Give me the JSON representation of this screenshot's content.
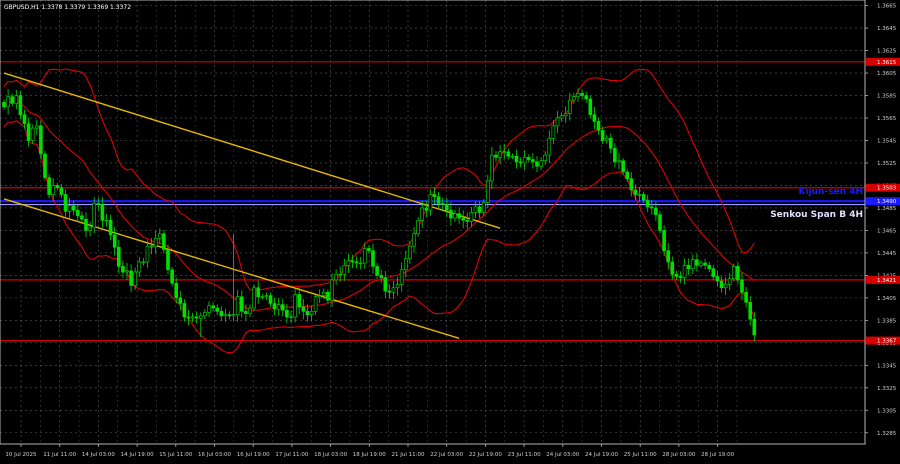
{
  "header": {
    "symbol_text": "GBPUSD,H1  1.3378 1.3379 1.3369 1.3372"
  },
  "chart_data": {
    "type": "candlestick",
    "symbol": "GBPUSD",
    "timeframe": "H1",
    "ohlc": {
      "open": 1.3378,
      "high": 1.3379,
      "low": 1.3369,
      "close": 1.3372
    },
    "y_range": [
      1.3275,
      1.367
    ],
    "y_ticks": [
      "1.3665",
      "1.3645",
      "1.3625",
      "1.3605",
      "1.3585",
      "1.3565",
      "1.3545",
      "1.3525",
      "1.3505",
      "1.3485",
      "1.3465",
      "1.3445",
      "1.3425",
      "1.3405",
      "1.3385",
      "1.3365",
      "1.3345",
      "1.3325",
      "1.3305",
      "1.3285"
    ],
    "x_ticks": [
      "10 Jul 2025",
      "11 Jul 11:00",
      "14 Jul 03:00",
      "14 Jul 19:00",
      "15 Jul 11:00",
      "16 Jul 03:00",
      "16 Jul 19:00",
      "17 Jul 11:00",
      "18 Jul 03:00",
      "18 Jul 19:00",
      "21 Jul 11:00",
      "22 Jul 03:00",
      "22 Jul 19:00",
      "23 Jul 11:00",
      "24 Jul 03:00",
      "24 Jul 19:00",
      "25 Jul 11:00",
      "28 Jul 03:00",
      "28 Jul 19:00"
    ],
    "levels": [
      {
        "price": 1.3615,
        "label": "1.3615",
        "color": "#d40000",
        "kind": "support-resistance"
      },
      {
        "price": 1.3503,
        "label": "1.3503",
        "color": "#d40000",
        "kind": "support-resistance"
      },
      {
        "price": 1.3491,
        "label": "1.3490",
        "color": "#1a1aff",
        "kind": "kijun-sen"
      },
      {
        "price": 1.3488,
        "label": "",
        "color": "#9a9aff",
        "kind": "senkou-span-b"
      },
      {
        "price": 1.3421,
        "label": "1.3421",
        "color": "#d40000",
        "kind": "support-resistance"
      },
      {
        "price": 1.3367,
        "label": "1.3367",
        "color": "#d40000",
        "kind": "support-resistance"
      }
    ],
    "level_labels": {
      "kijun": "Kijun-sen 4H",
      "senkou": "Senkou Span B 4H"
    },
    "trendlines": [
      {
        "color": "#e6b800",
        "from": {
          "bar": 0,
          "price": 1.3605
        },
        "to": {
          "bar": 121,
          "price": 1.3467
        }
      },
      {
        "color": "#e6b800",
        "from": {
          "bar": 0,
          "price": 1.3493
        },
        "to": {
          "bar": 111,
          "price": 1.3369
        }
      }
    ],
    "closes": [
      1.3575,
      1.3584,
      1.3578,
      1.3585,
      1.3568,
      1.356,
      1.3545,
      1.3556,
      1.3558,
      1.3533,
      1.3512,
      1.3497,
      1.3505,
      1.3503,
      1.3497,
      1.3482,
      1.3487,
      1.3483,
      1.3478,
      1.3475,
      1.3465,
      1.3468,
      1.3489,
      1.3488,
      1.3474,
      1.3474,
      1.3461,
      1.345,
      1.3433,
      1.3428,
      1.3429,
      1.3416,
      1.3428,
      1.3437,
      1.3437,
      1.3451,
      1.3451,
      1.3458,
      1.3462,
      1.3448,
      1.343,
      1.3418,
      1.3405,
      1.34,
      1.3388,
      1.3387,
      1.3388,
      1.3387,
      1.3389,
      1.3392,
      1.3398,
      1.3396,
      1.3393,
      1.3389,
      1.339,
      1.3389,
      1.339,
      1.3406,
      1.3393,
      1.3391,
      1.3396,
      1.3414,
      1.3406,
      1.3406,
      1.3407,
      1.34,
      1.3395,
      1.3399,
      1.3394,
      1.3388,
      1.3388,
      1.3408,
      1.3397,
      1.3393,
      1.339,
      1.3393,
      1.3406,
      1.3407,
      1.341,
      1.3403,
      1.3421,
      1.3426,
      1.3426,
      1.3434,
      1.3438,
      1.3437,
      1.3436,
      1.3436,
      1.3449,
      1.3447,
      1.3433,
      1.3425,
      1.3423,
      1.3411,
      1.341,
      1.3414,
      1.3417,
      1.343,
      1.344,
      1.3451,
      1.3462,
      1.3474,
      1.3485,
      1.3483,
      1.3497,
      1.3495,
      1.3489,
      1.3488,
      1.3483,
      1.3476,
      1.348,
      1.3476,
      1.3474,
      1.3473,
      1.3481,
      1.3486,
      1.3481,
      1.349,
      1.3509,
      1.3532,
      1.353,
      1.3535,
      1.3535,
      1.3531,
      1.3531,
      1.3526,
      1.3525,
      1.353,
      1.3528,
      1.3526,
      1.3522,
      1.3527,
      1.3532,
      1.3547,
      1.3558,
      1.3565,
      1.3567,
      1.3569,
      1.3581,
      1.3584,
      1.3587,
      1.3585,
      1.3582,
      1.3568,
      1.3562,
      1.3554,
      1.3545,
      1.3547,
      1.3538,
      1.3526,
      1.3527,
      1.3517,
      1.3511,
      1.3501,
      1.3497,
      1.3497,
      1.3492,
      1.3486,
      1.3485,
      1.3479,
      1.3465,
      1.3447,
      1.3437,
      1.3426,
      1.3424,
      1.3423,
      1.3434,
      1.3431,
      1.3439,
      1.3434,
      1.3436,
      1.3434,
      1.3431,
      1.3424,
      1.342,
      1.3414,
      1.3417,
      1.3422,
      1.3433,
      1.3421,
      1.341,
      1.3401,
      1.3386,
      1.3372
    ]
  }
}
